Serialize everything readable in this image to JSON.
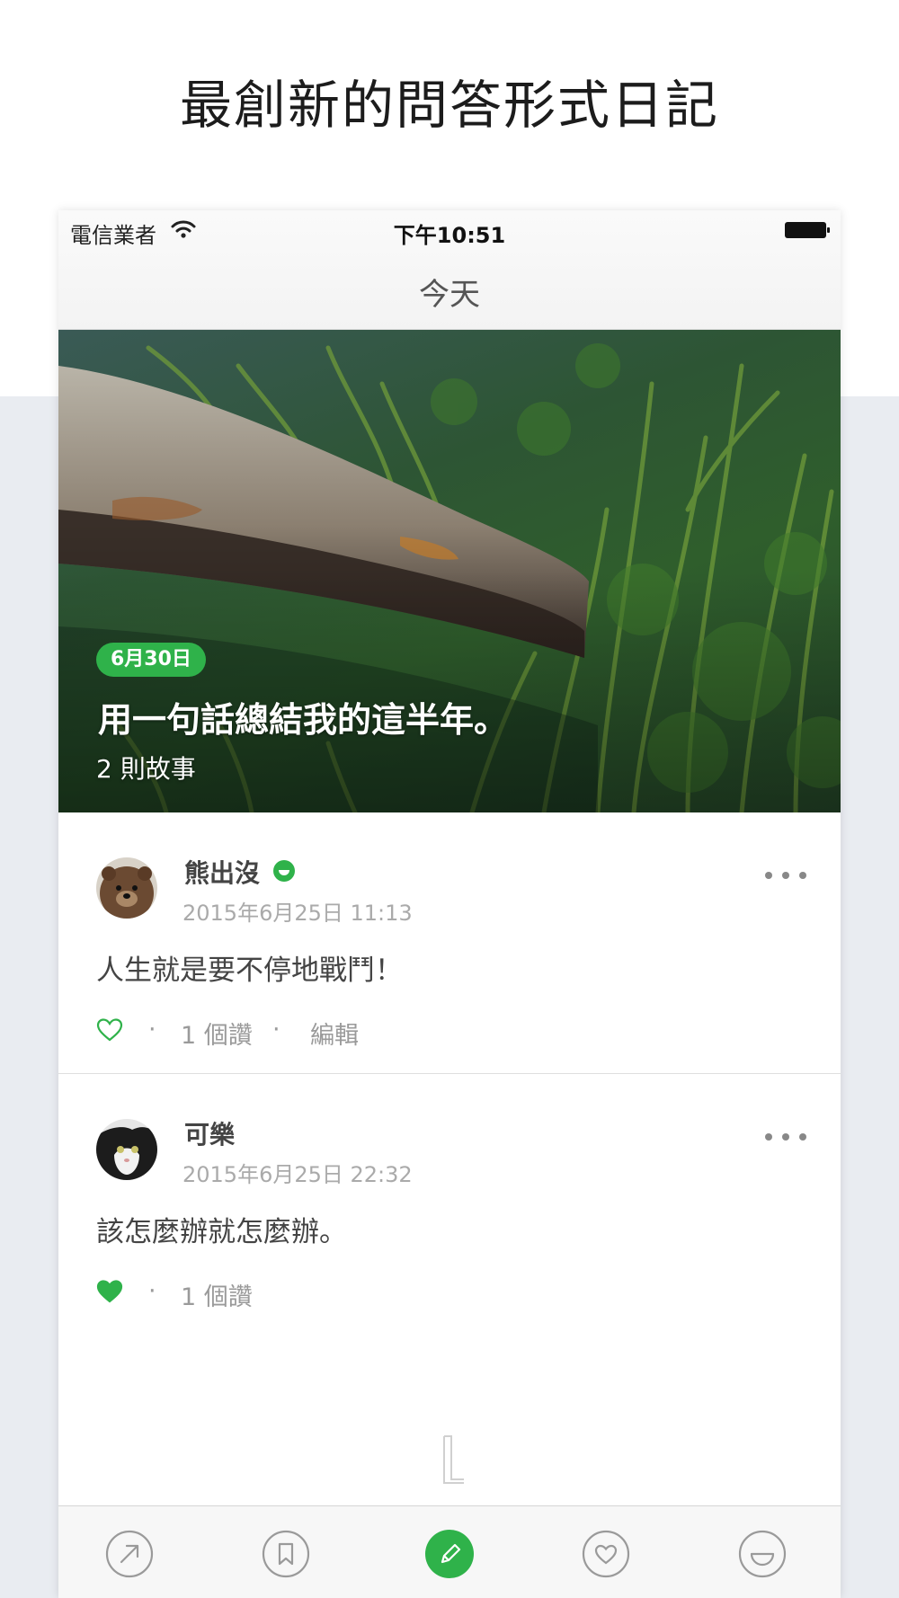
{
  "promo": {
    "headline": "最創新的問答形式日記"
  },
  "status_bar": {
    "carrier": "電信業者",
    "time": "下午10:51"
  },
  "nav": {
    "title": "今天"
  },
  "hero": {
    "date_badge": "6月30日",
    "question": "用一句話總結我的這半年。",
    "story_count": "2 則故事"
  },
  "posts": [
    {
      "name": "熊出沒",
      "timestamp": "2015年6月25日 11:13",
      "text": "人生就是要不停地戰鬥！",
      "liked": false,
      "likes": "1 個讚",
      "edit_label": "編輯",
      "avatar": "bear-avatar"
    },
    {
      "name": "可樂",
      "timestamp": "2015年6月25日 22:32",
      "text": "該怎麼辦就怎麼辦。",
      "liked": true,
      "likes": "1 個讚",
      "avatar": "cat-avatar"
    }
  ],
  "tabbar": {
    "icons": [
      "share-arrow-icon",
      "bookmark-icon",
      "pencil-icon",
      "heart-icon",
      "smile-icon"
    ]
  },
  "colors": {
    "accent": "#2fb24a",
    "bg": "#e9ecf1"
  }
}
